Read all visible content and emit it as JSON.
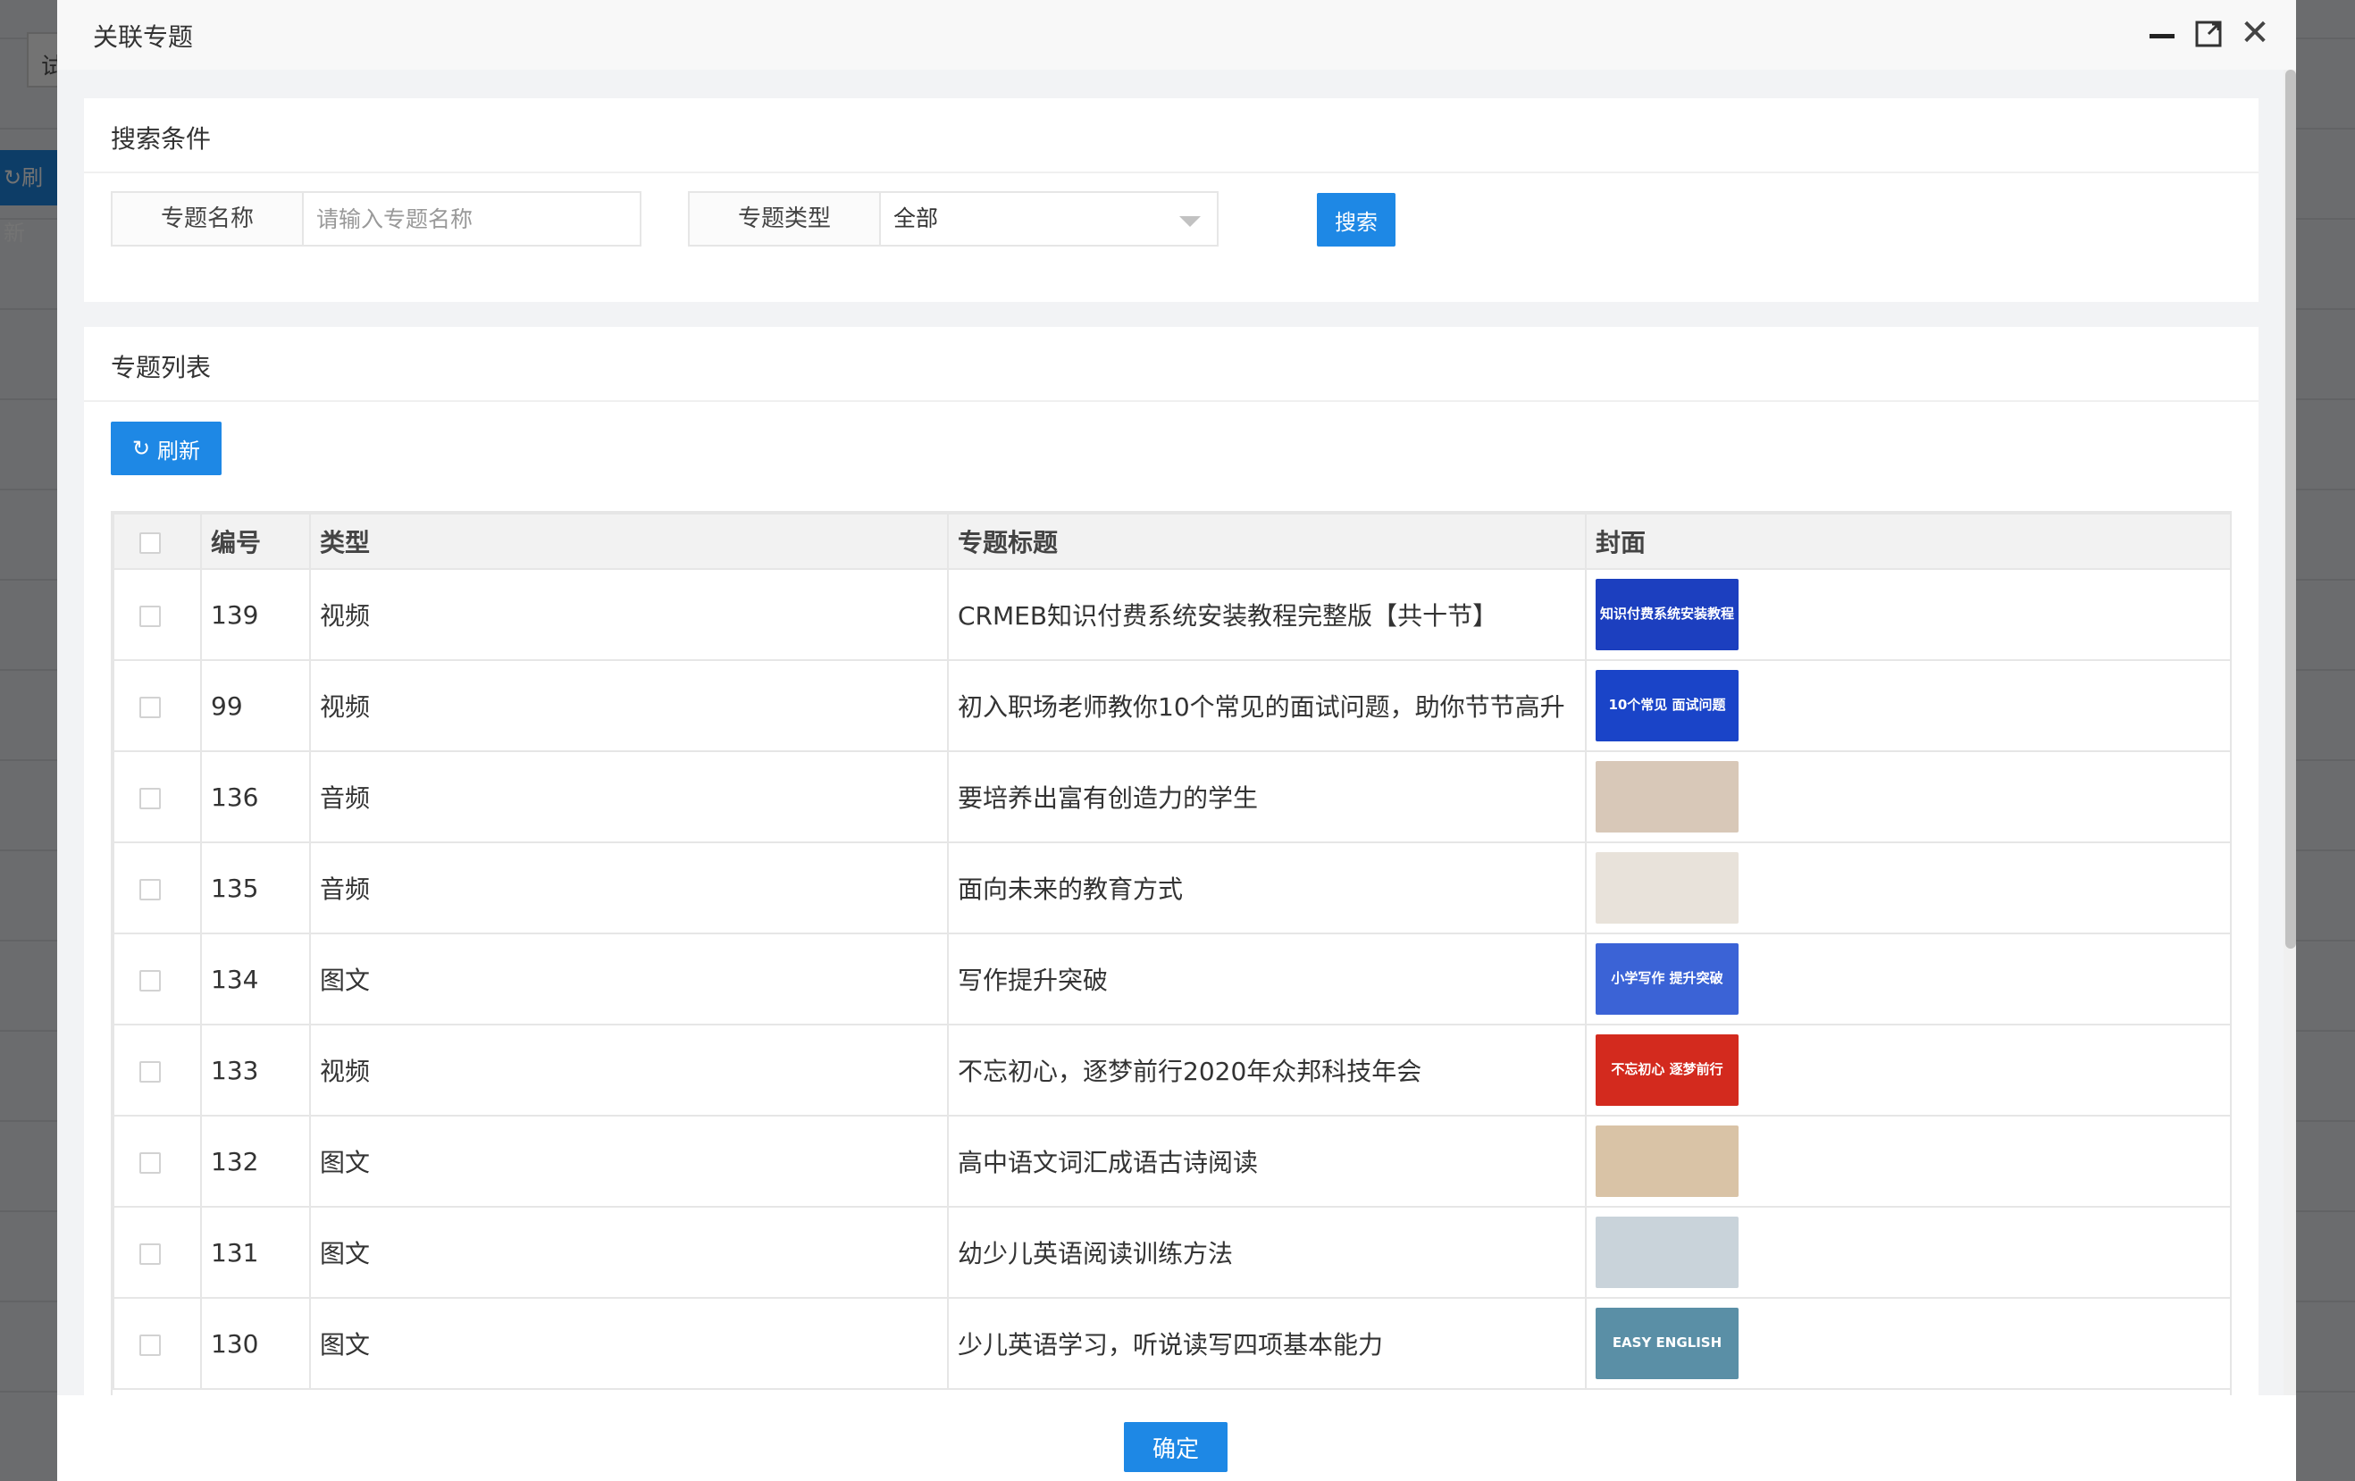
{
  "background": {
    "tab_label": "试",
    "refresh_label": "刷新"
  },
  "modal": {
    "title": "关联专题",
    "search": {
      "section_title": "搜索条件",
      "name_label": "专题名称",
      "name_placeholder": "请输入专题名称",
      "name_value": "",
      "type_label": "专题类型",
      "type_selected": "全部",
      "search_button": "搜索"
    },
    "list": {
      "section_title": "专题列表",
      "refresh_button": "刷新",
      "columns": [
        "",
        "编号",
        "类型",
        "专题标题",
        "封面"
      ],
      "rows": [
        {
          "id": "139",
          "type": "视频",
          "title": "CRMEB知识付费系统安装教程完整版【共十节】",
          "cover_text": "知识付费系统安装教程",
          "cover_color": "#1c3fbf"
        },
        {
          "id": "99",
          "type": "视频",
          "title": "初入职场老师教你10个常见的面试问题，助你节节高升",
          "cover_text": "10个常见 面试问题",
          "cover_color": "#1a44c8"
        },
        {
          "id": "136",
          "type": "音频",
          "title": "要培养出富有创造力的学生",
          "cover_text": "",
          "cover_color": "#d8c8b8"
        },
        {
          "id": "135",
          "type": "音频",
          "title": "面向未来的教育方式",
          "cover_text": "",
          "cover_color": "#e8e2da"
        },
        {
          "id": "134",
          "type": "图文",
          "title": "写作提升突破",
          "cover_text": "小学写作 提升突破",
          "cover_color": "#3b63d6"
        },
        {
          "id": "133",
          "type": "视频",
          "title": "不忘初心，逐梦前行2020年众邦科技年会",
          "cover_text": "不忘初心 逐梦前行",
          "cover_color": "#d32a1e"
        },
        {
          "id": "132",
          "type": "图文",
          "title": "高中语文词汇成语古诗阅读",
          "cover_text": "",
          "cover_color": "#d9c3a6"
        },
        {
          "id": "131",
          "type": "图文",
          "title": "幼少儿英语阅读训练方法",
          "cover_text": "",
          "cover_color": "#c9d3da"
        },
        {
          "id": "130",
          "type": "图文",
          "title": "少儿英语学习，听说读写四项基本能力",
          "cover_text": "EASY ENGLISH",
          "cover_color": "#5a8fa6"
        }
      ]
    },
    "confirm_button": "确定"
  },
  "colors": {
    "primary": "#1e88e5",
    "border": "#e6e6e6",
    "header_bg": "#f2f2f2"
  }
}
